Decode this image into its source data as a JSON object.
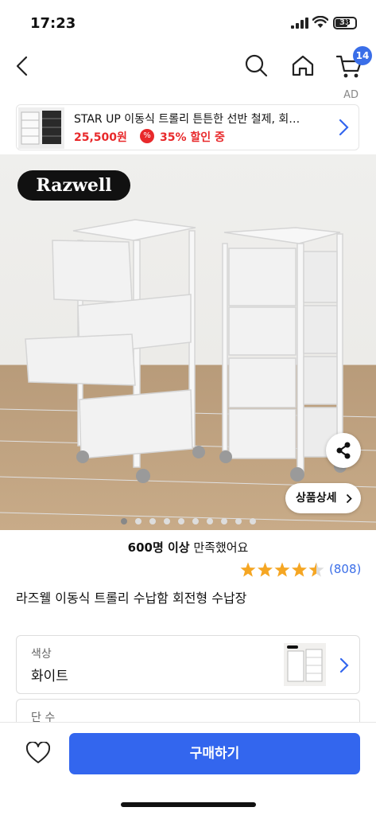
{
  "status_bar": {
    "time": "17:23",
    "battery": "33"
  },
  "nav": {
    "cart_count": "14"
  },
  "ad": {
    "tag": "AD",
    "title": "STAR UP 이동식 트롤리 튼튼한 선반 철제, 회…",
    "price": "25,500원",
    "discount_icon": "%",
    "discount": "35% 할인 중"
  },
  "hero": {
    "brand": "Razwell",
    "detail_button": "상품상세",
    "slides_total": 10,
    "slide_active": 1
  },
  "satisfaction": {
    "count": "600명 이상",
    "text": " 만족했어요"
  },
  "rating": {
    "stars": 4.5,
    "reviews": "(808)"
  },
  "product": {
    "title": "라즈웰 이동식 트롤리 수납함 회전형 수납장"
  },
  "options": [
    {
      "label": "색상",
      "value": "화이트"
    },
    {
      "label": "단 수",
      "value": ""
    }
  ],
  "bottom_bar": {
    "buy_label": "구매하기"
  },
  "colors": {
    "accent": "#3366ee",
    "price_red": "#e8292b",
    "star": "#f5a623"
  }
}
